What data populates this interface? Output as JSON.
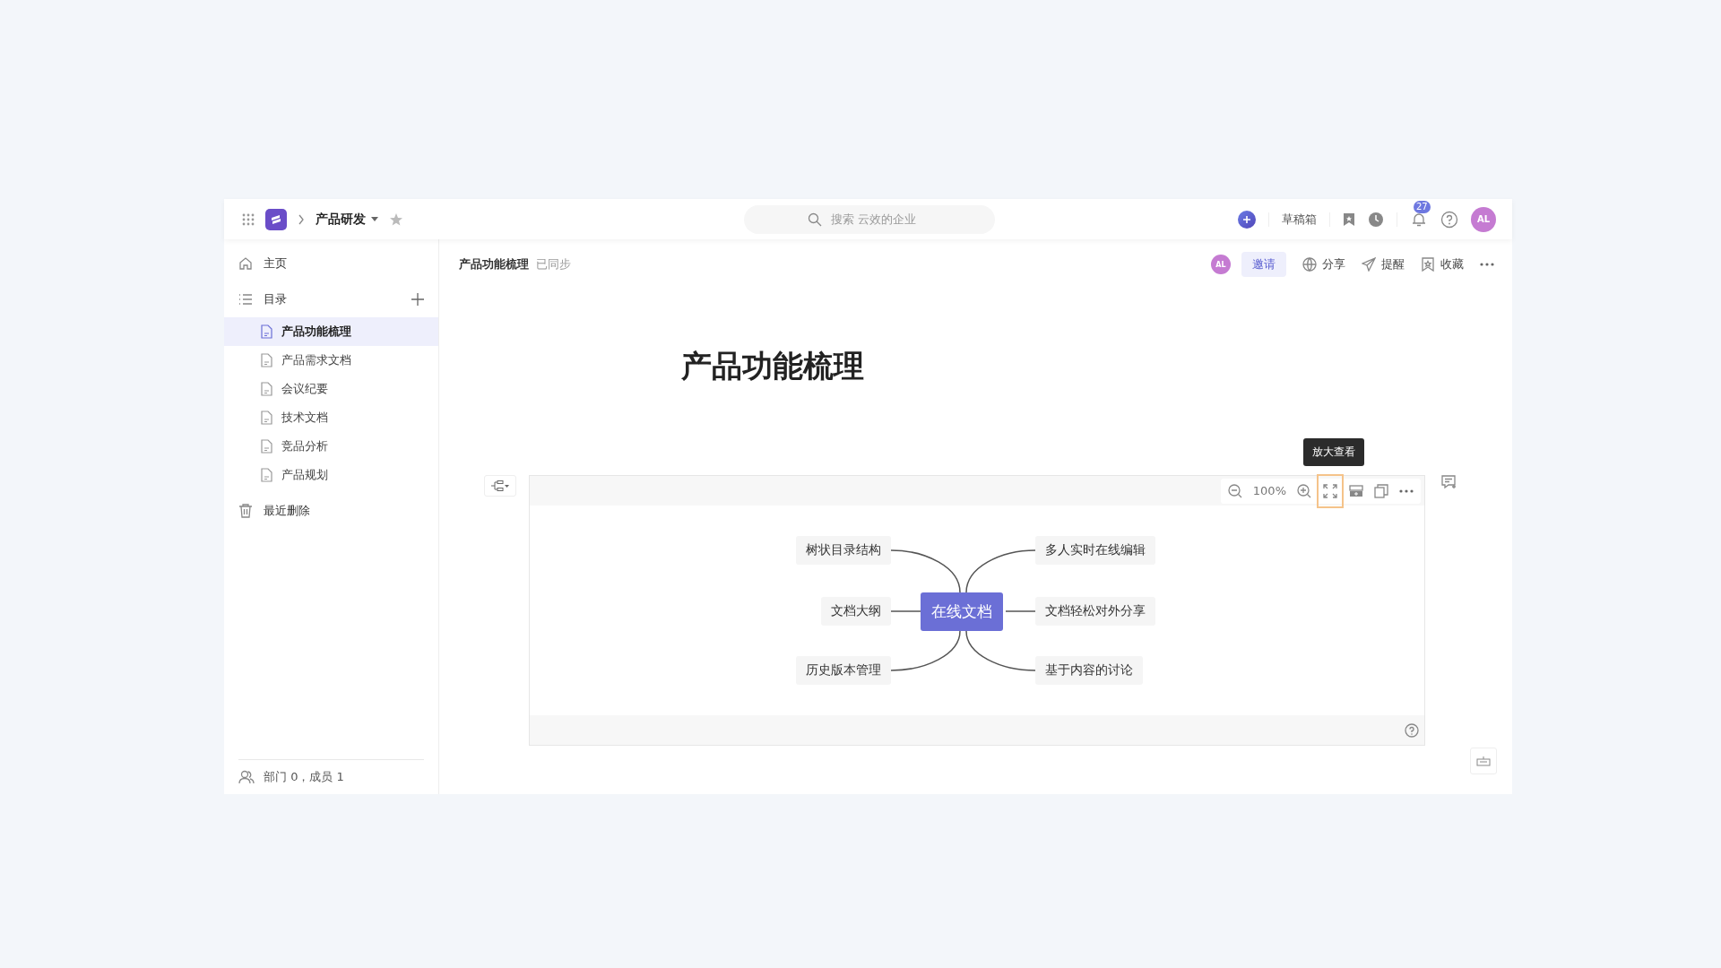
{
  "topbar": {
    "space": "产品研发",
    "search": {
      "placeholder": "搜索 云效的企业"
    },
    "drafts": "草稿箱",
    "notifications": "27",
    "avatar": "AL"
  },
  "sidebar": {
    "home": "主页",
    "catalog": "目录",
    "items": [
      {
        "label": "产品功能梳理",
        "selected": true
      },
      {
        "label": "产品需求文档",
        "selected": false
      },
      {
        "label": "会议纪要",
        "selected": false
      },
      {
        "label": "技术文档",
        "selected": false
      },
      {
        "label": "竞品分析",
        "selected": false
      },
      {
        "label": "产品规划",
        "selected": false
      }
    ],
    "trash": "最近删除",
    "footer": "部门 0，成员 1"
  },
  "doc_header": {
    "title": "产品功能梳理",
    "status": "已同步",
    "avatar": "AL",
    "invite": "邀请",
    "actions": [
      "分享",
      "提醒",
      "收藏"
    ]
  },
  "page_title": "产品功能梳理",
  "mindmap": {
    "zoom": "100%",
    "tooltip": "放大查看",
    "root": "在线文档",
    "left": [
      "树状目录结构",
      "文档大纲",
      "历史版本管理"
    ],
    "right": [
      "多人实时在线编辑",
      "文档轻松对外分享",
      "基于内容的讨论"
    ]
  }
}
